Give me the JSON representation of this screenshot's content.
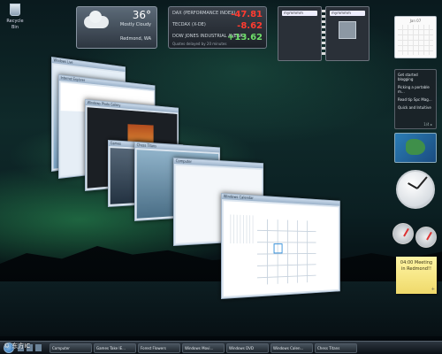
{
  "desktop": {
    "recycle_bin_label": "Recycle Bin"
  },
  "weather": {
    "temperature": "36°",
    "condition": "Mostly Cloudy",
    "location": "Redmond, WA"
  },
  "stocks": {
    "rows": [
      {
        "name": "DAX (PERFORMANCE INDEX)",
        "value": "-47.81",
        "trend": "neg"
      },
      {
        "name": "TECDAX (X-DE)",
        "value": "-8.62",
        "trend": "neg"
      },
      {
        "name": "DOW JONES INDUSTRIAL AVERA...",
        "value": "+13.62",
        "trend": "pos"
      }
    ],
    "footer": "Quotes delayed by 20 minutes"
  },
  "contacts": {
    "left_search": "mymmmm",
    "right_search": "mymmmm"
  },
  "calendar_gadget": {
    "month": "Jan 07"
  },
  "feeds": {
    "items": [
      "Get started blogging",
      "Picking a portable m...",
      "Read tip Spc Mag...",
      "Quick and Intuitive"
    ],
    "pager": "1/4 ▸"
  },
  "note": {
    "text": "04:00 Meeting in Redmond!!",
    "add_label": "+"
  },
  "windows": {
    "w1": "Windows Live",
    "w2": "Internet Explorer",
    "w3": "Windows Photo Gallery",
    "w4": "Games",
    "w5": "Chess Titans",
    "w6": "Computer",
    "w7": "Windows Calendar"
  },
  "taskbar": {
    "tasks": [
      "Computer",
      "Games Take IE...",
      "Forest Flowers",
      "Windows Movi...",
      "Windows DVD",
      "Windows Calen...",
      "Chess Titans"
    ],
    "tray_time": ""
  },
  "watermark": "© 东方IC"
}
